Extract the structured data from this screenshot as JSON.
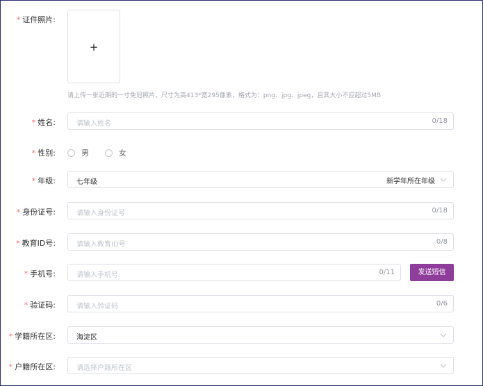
{
  "required_mark": "*",
  "photo": {
    "label": "证件照片:",
    "upload_symbol": "+",
    "hint": "请上传一张近期的一寸免冠照片，尺寸为高413*宽295像素，格式为：png、jpg、jpeg，且其大小不应超过5MB"
  },
  "name": {
    "label": "姓名:",
    "placeholder": "请输入姓名",
    "counter": "0/18"
  },
  "gender": {
    "label": "性别:",
    "options": [
      "男",
      "女"
    ]
  },
  "grade": {
    "label": "年级:",
    "value": "七年级",
    "note": "新学年所在年级"
  },
  "id_card": {
    "label": "身份证号:",
    "placeholder": "请输入身份证号",
    "counter": "0/18"
  },
  "edu_id": {
    "label": "教育ID号:",
    "placeholder": "请输入教育ID号",
    "counter": "0/8"
  },
  "phone": {
    "label": "手机号:",
    "placeholder": "请输入手机号",
    "counter": "0/11",
    "sms_button": "发送短信"
  },
  "code": {
    "label": "验证码:",
    "placeholder": "请输入验证码",
    "counter": "0/6"
  },
  "school_district": {
    "label": "学籍所在区:",
    "value": "海淀区"
  },
  "household_district": {
    "label": "户籍所在区:",
    "placeholder": "请选择户籍所在区"
  },
  "colors": {
    "accent": "#8e3d9b",
    "required": "#f56c6c",
    "border": "#dcdfe6"
  }
}
